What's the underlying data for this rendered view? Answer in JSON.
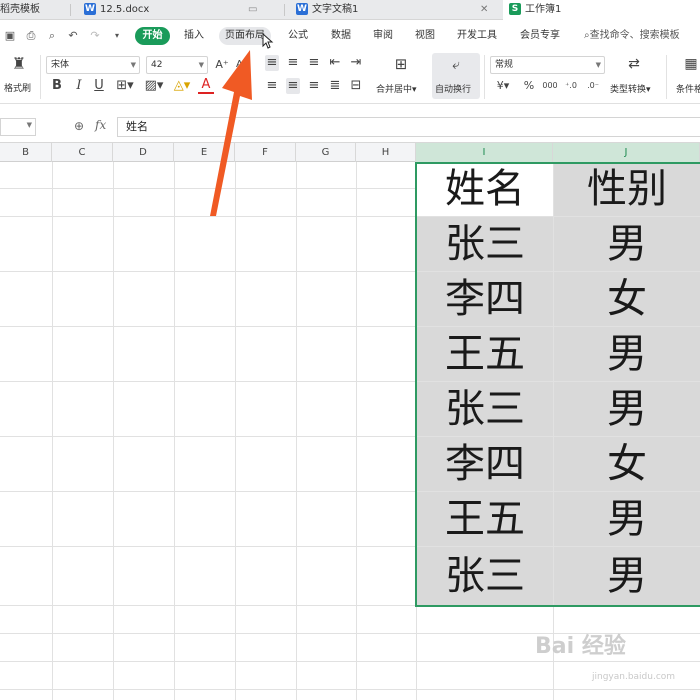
{
  "tabs": [
    {
      "label": "稻壳模板"
    },
    {
      "label": "12.5.docx",
      "icon": "W"
    },
    {
      "label": "文字文稿1",
      "icon": "W"
    },
    {
      "label": "工作簿1",
      "icon": "S"
    }
  ],
  "menu": {
    "start": "开始",
    "insert": "插入",
    "page_layout": "页面布局",
    "formula": "公式",
    "data": "数据",
    "review": "审阅",
    "view": "视图",
    "developer": "开发工具",
    "member": "会员专享",
    "search_placeholder": "查找命令、搜索模板"
  },
  "ribbon": {
    "format_painter": "格式刷",
    "font_name": "宋体",
    "font_size": "42",
    "bold": "B",
    "italic": "I",
    "underline": "U",
    "merge_center": "合并居中",
    "wrap_text": "自动换行",
    "number_format": "常规",
    "type_convert": "类型转换",
    "conditional": "条件格",
    "currency": "¥",
    "percent": "%",
    "thousands": "000"
  },
  "formula_bar": {
    "fx": "fx",
    "value": "姓名"
  },
  "columns": [
    "B",
    "C",
    "D",
    "E",
    "F",
    "G",
    "H",
    "I",
    "J"
  ],
  "table": {
    "header": [
      "姓名",
      "性别"
    ],
    "rows": [
      [
        "张三",
        "男"
      ],
      [
        "李四",
        "女"
      ],
      [
        "王五",
        "男"
      ],
      [
        "张三",
        "男"
      ],
      [
        "李四",
        "女"
      ],
      [
        "王五",
        "男"
      ],
      [
        "张三",
        "男"
      ]
    ]
  },
  "watermark": "Bai 经验",
  "watermark_sub": "jingyan.baidu.com",
  "colors": {
    "accent": "#1a9b5a",
    "selection_fill": "#d9d9d9",
    "selection_border": "#2e9a62",
    "arrow": "#f05a24"
  }
}
